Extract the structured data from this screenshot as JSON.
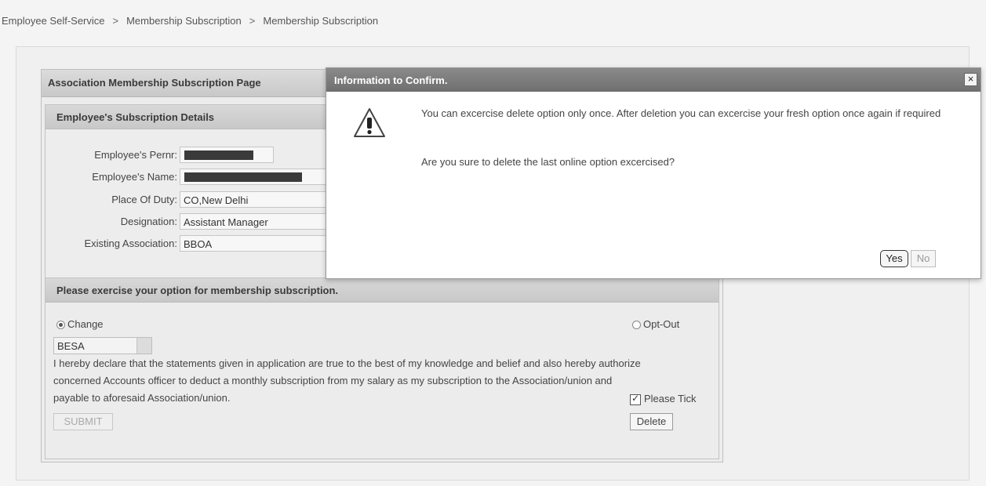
{
  "breadcrumb": {
    "items": [
      "Employee Self-Service",
      "Membership Subscription",
      "Membership Subscription"
    ],
    "separator": ">"
  },
  "page": {
    "title": "Association Membership Subscription Page"
  },
  "details": {
    "header": "Employee's Subscription Details",
    "fields": [
      {
        "label": "Employee's Pernr:",
        "value": ""
      },
      {
        "label": "Employee's Name:",
        "value": ""
      },
      {
        "label": "Place Of Duty:",
        "value": "CO,New Delhi"
      },
      {
        "label": "Designation:",
        "value": "Assistant Manager"
      },
      {
        "label": "Existing Association:",
        "value": "BBOA"
      }
    ]
  },
  "option": {
    "header": "Please exercise your option for membership subscription.",
    "change_label": "Change",
    "optout_label": "Opt-Out",
    "selected_association": "BESA",
    "declaration": "I hereby declare that the statements given in application are true to the best of my knowledge and belief and also hereby authorize concerned Accounts officer to deduct a monthly subscription from my salary as my subscription to the Association/union and payable to aforesaid Association/union.",
    "tick_label": "Please Tick",
    "submit_label": "SUBMIT",
    "delete_label": "Delete"
  },
  "dialog": {
    "title": "Information to Confirm.",
    "close_label": "×",
    "message": "You can excercise delete option only once. After deletion you can excercise your fresh option once again if required",
    "question": "Are you sure to delete the last online option excercised?",
    "yes_label": "Yes",
    "no_label": "No"
  }
}
